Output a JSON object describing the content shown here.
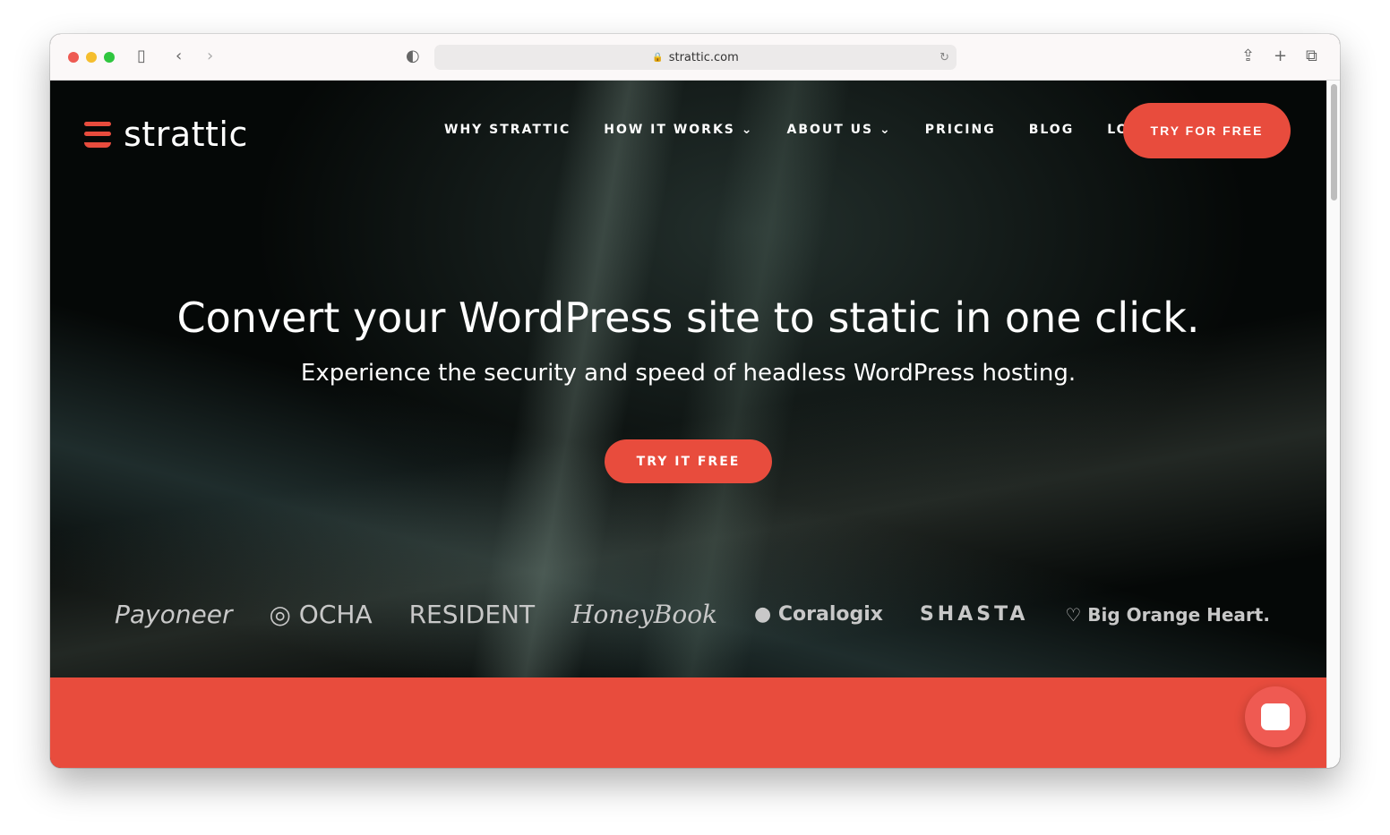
{
  "browser": {
    "url": "strattic.com"
  },
  "nav": {
    "logo": "strattic",
    "items": [
      "WHY STRATTIC",
      "HOW IT WORKS ⌄",
      "ABOUT US ⌄",
      "PRICING",
      "BLOG",
      "LOG IN"
    ],
    "cta": "TRY FOR FREE"
  },
  "hero": {
    "title": "Convert your WordPress site to static in one click.",
    "subtitle": "Experience the security and speed of headless WordPress hosting.",
    "button": "TRY IT FREE"
  },
  "clients": [
    "Payoneer",
    "OCHA",
    "RESIDENT",
    "HoneyBook",
    "Coralogix",
    "SHASTA",
    "Big Orange Heart."
  ],
  "colors": {
    "accent": "#e84c3d"
  }
}
